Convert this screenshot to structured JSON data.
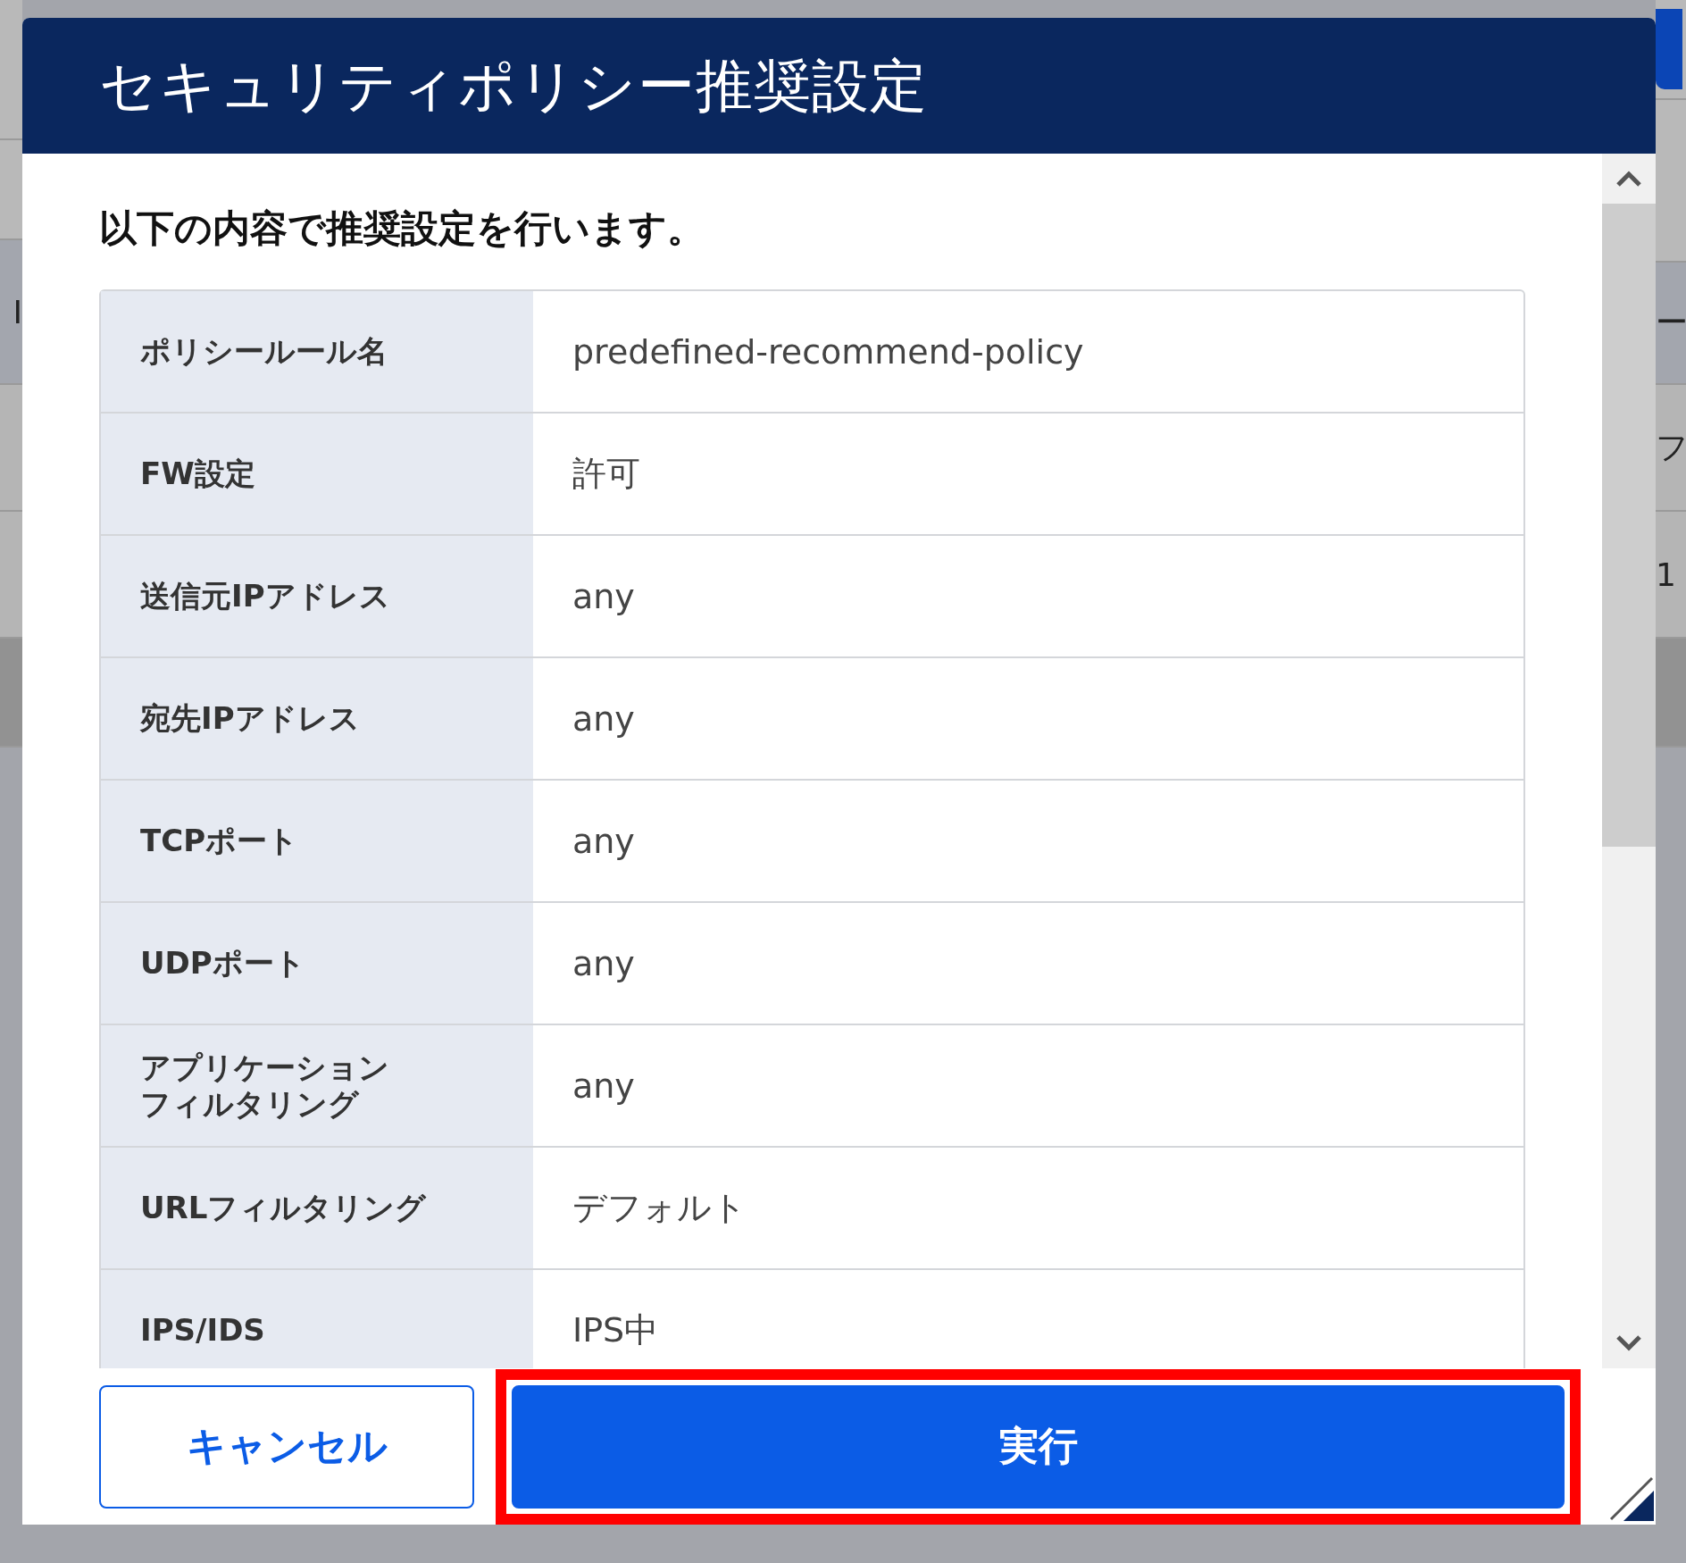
{
  "background": {
    "left_fragments": [
      "I"
    ],
    "right_fragments": [
      "ー",
      "フ",
      "1"
    ]
  },
  "dialog": {
    "title": "セキュリティポリシー推奨設定",
    "heading": "以下の内容で推奨設定を行います。",
    "rows": [
      {
        "label": "ポリシールール名",
        "value": "predefined-recommend-policy"
      },
      {
        "label": "FW設定",
        "value": "許可"
      },
      {
        "label": "送信元IPアドレス",
        "value": "any"
      },
      {
        "label": "宛先IPアドレス",
        "value": "any"
      },
      {
        "label": "TCPポート",
        "value": "any"
      },
      {
        "label": "UDPポート",
        "value": "any"
      },
      {
        "label": [
          "アプリケーション",
          "フィルタリング"
        ],
        "value": "any"
      },
      {
        "label": "URLフィルタリング",
        "value": "デフォルト"
      },
      {
        "label": "IPS/IDS",
        "value": "IPS中"
      }
    ],
    "buttons": [
      {
        "kind": "secondary",
        "label": "キャンセル",
        "highlighted": false
      },
      {
        "kind": "primary",
        "label": "実行",
        "highlighted": true
      }
    ]
  }
}
